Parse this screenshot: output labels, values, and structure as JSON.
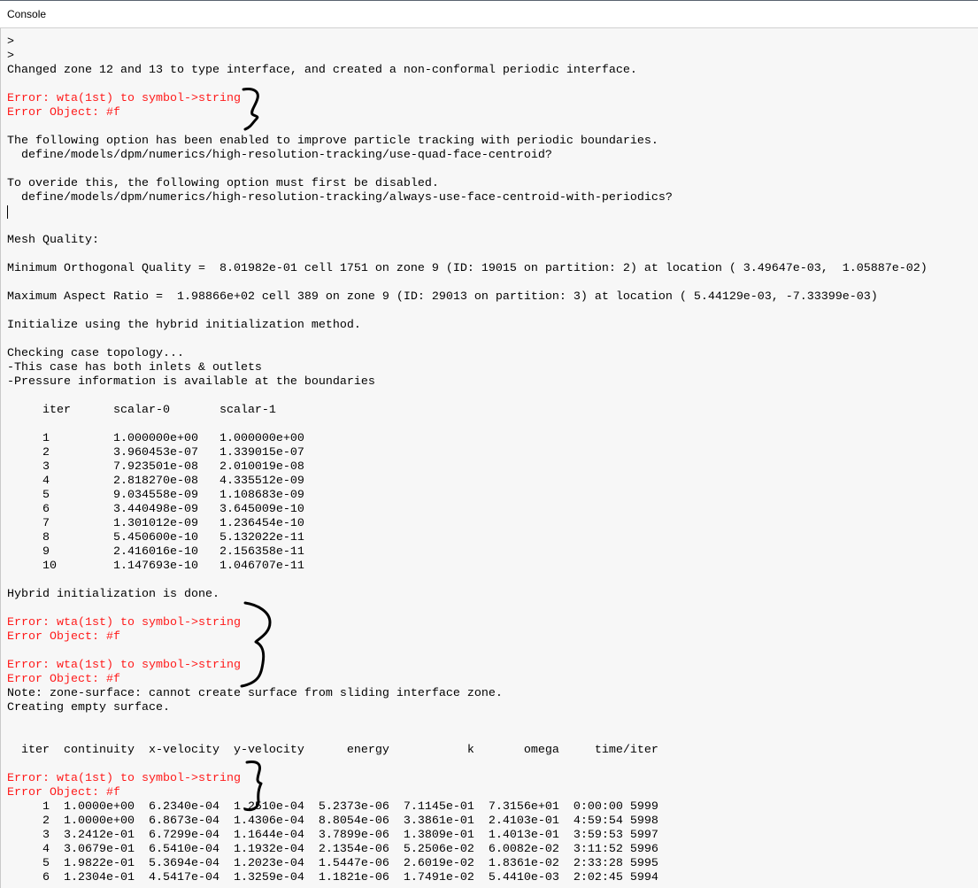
{
  "window": {
    "title": "Console"
  },
  "console": {
    "lines": [
      {
        "t": ">",
        "k": "normal"
      },
      {
        "t": ">",
        "k": "normal"
      },
      {
        "t": "Changed zone 12 and 13 to type interface, and created a non-conformal periodic interface.",
        "k": "normal"
      },
      {
        "t": "",
        "k": "normal"
      },
      {
        "t": "Error: wta(1st) to symbol->string",
        "k": "error"
      },
      {
        "t": "Error Object: #f",
        "k": "error"
      },
      {
        "t": "",
        "k": "normal"
      },
      {
        "t": "The following option has been enabled to improve particle tracking with periodic boundaries.",
        "k": "normal"
      },
      {
        "t": "  define/models/dpm/numerics/high-resolution-tracking/use-quad-face-centroid?",
        "k": "normal"
      },
      {
        "t": "",
        "k": "normal"
      },
      {
        "t": "To overide this, the following option must first be disabled.",
        "k": "normal"
      },
      {
        "t": "  define/models/dpm/numerics/high-resolution-tracking/always-use-face-centroid-with-periodics?",
        "k": "normal"
      },
      {
        "t": "",
        "k": "caret"
      },
      {
        "t": "",
        "k": "normal"
      },
      {
        "t": "Mesh Quality:",
        "k": "normal"
      },
      {
        "t": "",
        "k": "normal"
      },
      {
        "t": "Minimum Orthogonal Quality =  8.01982e-01 cell 1751 on zone 9 (ID: 19015 on partition: 2) at location ( 3.49647e-03,  1.05887e-02)",
        "k": "normal"
      },
      {
        "t": "",
        "k": "normal"
      },
      {
        "t": "Maximum Aspect Ratio =  1.98866e+02 cell 389 on zone 9 (ID: 29013 on partition: 3) at location ( 5.44129e-03, -7.33399e-03)",
        "k": "normal"
      },
      {
        "t": "",
        "k": "normal"
      },
      {
        "t": "Initialize using the hybrid initialization method.",
        "k": "normal"
      },
      {
        "t": "",
        "k": "normal"
      },
      {
        "t": "Checking case topology...",
        "k": "normal"
      },
      {
        "t": "-This case has both inlets & outlets",
        "k": "normal"
      },
      {
        "t": "-Pressure information is available at the boundaries",
        "k": "normal"
      },
      {
        "t": "",
        "k": "normal"
      },
      {
        "t": "     iter      scalar-0       scalar-1",
        "k": "normal"
      },
      {
        "t": "",
        "k": "normal"
      },
      {
        "t": "     1         1.000000e+00   1.000000e+00",
        "k": "normal"
      },
      {
        "t": "     2         3.960453e-07   1.339015e-07",
        "k": "normal"
      },
      {
        "t": "     3         7.923501e-08   2.010019e-08",
        "k": "normal"
      },
      {
        "t": "     4         2.818270e-08   4.335512e-09",
        "k": "normal"
      },
      {
        "t": "     5         9.034558e-09   1.108683e-09",
        "k": "normal"
      },
      {
        "t": "     6         3.440498e-09   3.645009e-10",
        "k": "normal"
      },
      {
        "t": "     7         1.301012e-09   1.236454e-10",
        "k": "normal"
      },
      {
        "t": "     8         5.450600e-10   5.132022e-11",
        "k": "normal"
      },
      {
        "t": "     9         2.416016e-10   2.156358e-11",
        "k": "normal"
      },
      {
        "t": "     10        1.147693e-10   1.046707e-11",
        "k": "normal"
      },
      {
        "t": "",
        "k": "normal"
      },
      {
        "t": "Hybrid initialization is done.",
        "k": "normal"
      },
      {
        "t": "",
        "k": "normal"
      },
      {
        "t": "Error: wta(1st) to symbol->string",
        "k": "error"
      },
      {
        "t": "Error Object: #f",
        "k": "error"
      },
      {
        "t": "",
        "k": "normal"
      },
      {
        "t": "Error: wta(1st) to symbol->string",
        "k": "error"
      },
      {
        "t": "Error Object: #f",
        "k": "error"
      },
      {
        "t": "Note: zone-surface: cannot create surface from sliding interface zone.",
        "k": "normal"
      },
      {
        "t": "Creating empty surface.",
        "k": "normal"
      },
      {
        "t": "",
        "k": "normal"
      },
      {
        "t": "",
        "k": "normal"
      },
      {
        "t": "  iter  continuity  x-velocity  y-velocity      energy           k       omega     time/iter",
        "k": "normal"
      },
      {
        "t": "",
        "k": "normal"
      },
      {
        "t": "Error: wta(1st) to symbol->string",
        "k": "error"
      },
      {
        "t": "Error Object: #f",
        "k": "error"
      },
      {
        "t": "     1  1.0000e+00  6.2340e-04  1.2510e-04  5.2373e-06  7.1145e-01  7.3156e+01  0:00:00 5999",
        "k": "normal"
      },
      {
        "t": "     2  1.0000e+00  6.8673e-04  1.4306e-04  8.8054e-06  3.3861e-01  2.4103e-01  4:59:54 5998",
        "k": "normal"
      },
      {
        "t": "     3  3.2412e-01  6.7299e-04  1.1644e-04  3.7899e-06  1.3809e-01  1.4013e-01  3:59:53 5997",
        "k": "normal"
      },
      {
        "t": "     4  3.0679e-01  6.5410e-04  1.1932e-04  2.1354e-06  5.2506e-02  6.0082e-02  3:11:52 5996",
        "k": "normal"
      },
      {
        "t": "     5  1.9822e-01  5.3694e-04  1.2023e-04  1.5447e-06  2.6019e-02  1.8361e-02  2:33:28 5995",
        "k": "normal"
      },
      {
        "t": "     6  1.2304e-01  4.5417e-04  1.3259e-04  1.1821e-06  1.7491e-02  5.4410e-03  2:02:45 5994",
        "k": "normal"
      }
    ]
  }
}
